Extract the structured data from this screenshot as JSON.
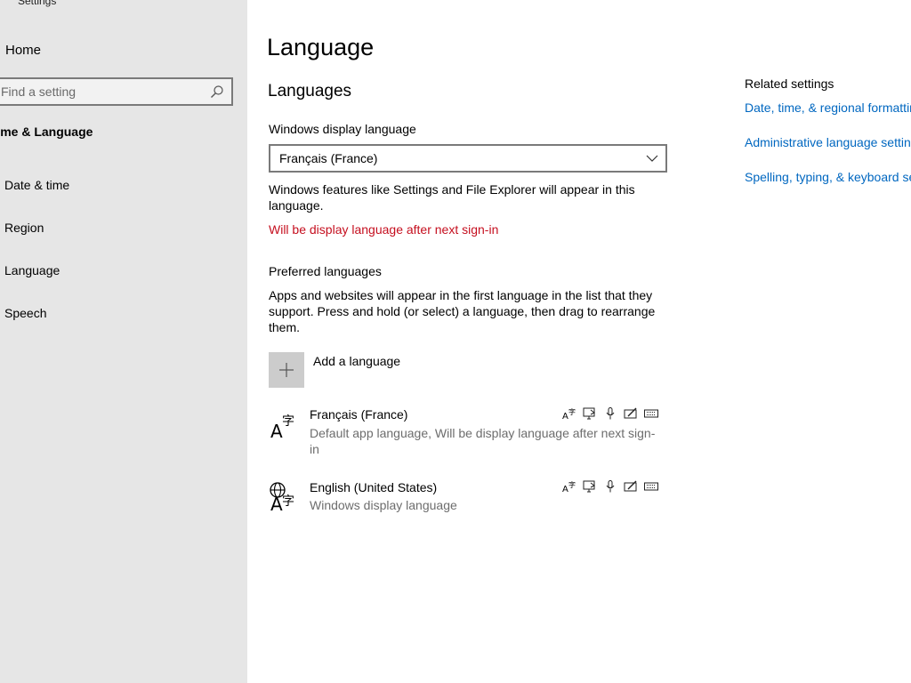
{
  "app": {
    "title": "Settings"
  },
  "sidebar": {
    "home_label": "Home",
    "search_placeholder": "Find a setting",
    "group_title": "Time & Language",
    "items": [
      {
        "label": "Date & time"
      },
      {
        "label": "Region"
      },
      {
        "label": "Language"
      },
      {
        "label": "Speech"
      }
    ]
  },
  "main": {
    "page_title": "Language",
    "section_title": "Languages",
    "display_language_label": "Windows display language",
    "display_language_value": "Français (France)",
    "display_language_desc": "Windows features like Settings and File Explorer will appear in this language.",
    "display_language_warning": "Will be display language after next sign-in",
    "preferred_label": "Preferred languages",
    "preferred_desc": "Apps and websites will appear in the first language in the list that they support. Press and hold (or select) a language, then drag to rearrange them.",
    "add_language_label": "Add a language",
    "languages": [
      {
        "name": "Français (France)",
        "status": "Default app language, Will be display language after next sign-in"
      },
      {
        "name": "English (United States)",
        "status": "Windows display language"
      }
    ]
  },
  "related": {
    "title": "Related settings",
    "links": [
      "Date, time, & regional formatting",
      "Administrative language settings",
      "Spelling, typing, & keyboard settings"
    ]
  },
  "colors": {
    "accent": "#0067c0",
    "warning": "#c50f1f",
    "sidebar_bg": "#e6e6e6"
  },
  "icons": [
    "search-icon",
    "chevron-down-icon",
    "plus-icon",
    "language-icon",
    "globe-language-icon",
    "language-pack-icon",
    "text-to-speech-icon",
    "speech-recognition-icon",
    "handwriting-icon",
    "keyboard-icon"
  ]
}
